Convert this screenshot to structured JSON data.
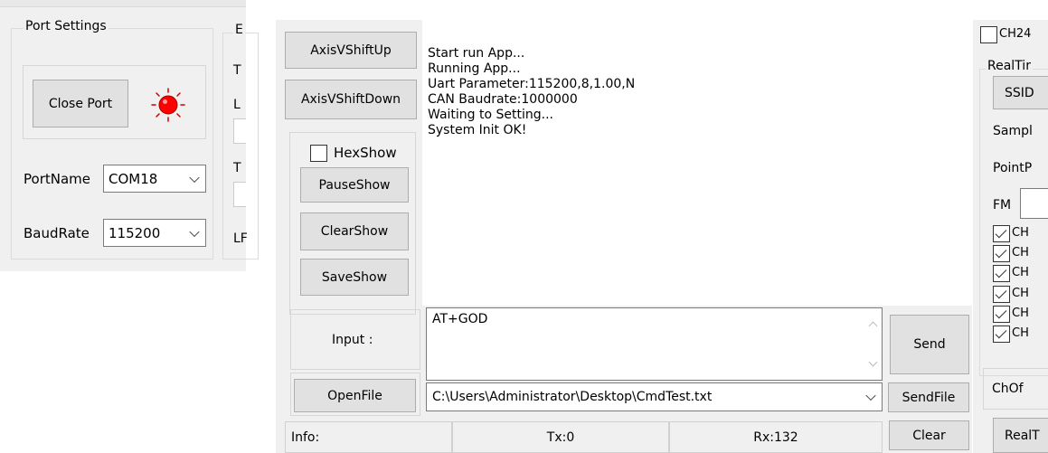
{
  "port_settings": {
    "title": "Port Settings",
    "close_port_label": "Close Port",
    "portname_label": "PortName",
    "portname_value": "COM18",
    "baudrate_label": "BaudRate",
    "baudrate_value": "115200",
    "status_color": "#ff0000"
  },
  "partial_group": {
    "title": "E",
    "labels": [
      "T",
      "L",
      "T",
      "LF"
    ]
  },
  "axis": {
    "shift_up_label": "AxisVShiftUp",
    "shift_down_label": "AxisVShiftDown"
  },
  "show_controls": {
    "hexshow_label": "HexShow",
    "hexshow_checked": false,
    "pause_label": "PauseShow",
    "clear_label": "ClearShow",
    "save_label": "SaveShow"
  },
  "log": {
    "lines": [
      "Start run App...",
      "Running App...",
      "Uart Parameter:115200,8,1.00,N",
      "CAN Baudrate:1000000",
      "Waiting to Setting...",
      "System Init OK!"
    ]
  },
  "input": {
    "label": "Input :",
    "value": "AT+GOD",
    "send_label": "Send"
  },
  "file": {
    "open_label": "OpenFile",
    "path": "C:\\Users\\Administrator\\Desktop\\CmdTest.txt",
    "sendfile_label": "SendFile"
  },
  "status": {
    "info": "Info:",
    "tx": "Tx:0",
    "rx": "Rx:132",
    "clear_label": "Clear"
  },
  "right_panel": {
    "ch24_label": "CH24",
    "realtime_title": "RealTir",
    "ssid_label": "SSID",
    "sampl_label": "Sampl",
    "pointp_label": "PointP",
    "fm_label": "FM",
    "channels": [
      {
        "label": "CH",
        "checked": true
      },
      {
        "label": "CH",
        "checked": true
      },
      {
        "label": "CH",
        "checked": true
      },
      {
        "label": "CH",
        "checked": true
      },
      {
        "label": "CH",
        "checked": true
      },
      {
        "label": "CH",
        "checked": true
      }
    ],
    "choff_label": "ChOf",
    "real_label": "RealT"
  },
  "colors": {
    "panel_bg": "#f0f0f0",
    "button_bg": "#e1e1e1",
    "status_led": "#ff0000"
  }
}
